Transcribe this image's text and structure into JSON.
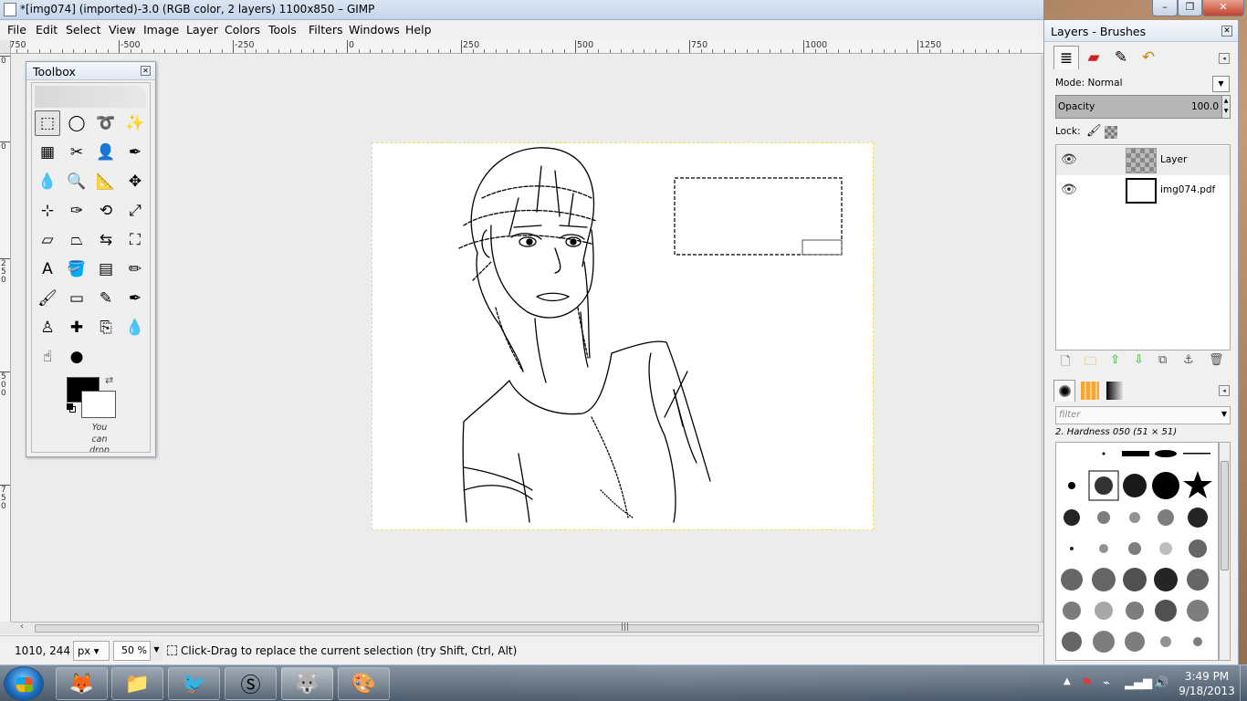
{
  "window": {
    "title": "*[img074] (imported)-3.0 (RGB color, 2 layers) 1100x850 – GIMP",
    "minimize": "–",
    "maximize": "❐",
    "close": "✕"
  },
  "menu": [
    "File",
    "Edit",
    "Select",
    "View",
    "Image",
    "Layer",
    "Colors",
    "Tools",
    "Filters",
    "Windows",
    "Help"
  ],
  "ruler": {
    "h_labels": [
      "-750",
      "-500",
      "-250",
      "0",
      "250",
      "500",
      "750",
      "1000",
      "1250"
    ],
    "v_labels": [
      "0",
      "0",
      "250",
      "500",
      "750"
    ]
  },
  "toolbox": {
    "title": "Toolbox",
    "close": "✕",
    "tools": [
      {
        "name": "rect-select-tool-icon",
        "glyph": "⬚"
      },
      {
        "name": "ellipse-select-tool-icon",
        "glyph": "◯"
      },
      {
        "name": "free-select-tool-icon",
        "glyph": "➰"
      },
      {
        "name": "fuzzy-select-tool-icon",
        "glyph": "✨"
      },
      {
        "name": "select-by-color-tool-icon",
        "glyph": "▦"
      },
      {
        "name": "scissors-select-tool-icon",
        "glyph": "✂"
      },
      {
        "name": "foreground-select-tool-icon",
        "glyph": "👤"
      },
      {
        "name": "paths-tool-icon",
        "glyph": "✒"
      },
      {
        "name": "color-picker-tool-icon",
        "glyph": "💧"
      },
      {
        "name": "zoom-tool-icon",
        "glyph": "🔍"
      },
      {
        "name": "measure-tool-icon",
        "glyph": "📐"
      },
      {
        "name": "move-tool-icon",
        "glyph": "✥"
      },
      {
        "name": "align-tool-icon",
        "glyph": "⊹"
      },
      {
        "name": "crop-tool-icon",
        "glyph": "✑"
      },
      {
        "name": "rotate-tool-icon",
        "glyph": "⟲"
      },
      {
        "name": "scale-tool-icon",
        "glyph": "⤢"
      },
      {
        "name": "shear-tool-icon",
        "glyph": "▱"
      },
      {
        "name": "perspective-tool-icon",
        "glyph": "⏢"
      },
      {
        "name": "flip-tool-icon",
        "glyph": "⇆"
      },
      {
        "name": "cage-transform-tool-icon",
        "glyph": "⛶"
      },
      {
        "name": "text-tool-icon",
        "glyph": "A"
      },
      {
        "name": "bucket-fill-tool-icon",
        "glyph": "🪣"
      },
      {
        "name": "blend-tool-icon",
        "glyph": "▤"
      },
      {
        "name": "pencil-tool-icon",
        "glyph": "✏"
      },
      {
        "name": "paintbrush-tool-icon",
        "glyph": "🖌"
      },
      {
        "name": "eraser-tool-icon",
        "glyph": "▭"
      },
      {
        "name": "airbrush-tool-icon",
        "glyph": "✎"
      },
      {
        "name": "ink-tool-icon",
        "glyph": "✒"
      },
      {
        "name": "clone-tool-icon",
        "glyph": "♙"
      },
      {
        "name": "heal-tool-icon",
        "glyph": "✚"
      },
      {
        "name": "perspective-clone-tool-icon",
        "glyph": "⎘"
      },
      {
        "name": "blur-sharpen-tool-icon",
        "glyph": "💧"
      },
      {
        "name": "smudge-tool-icon",
        "glyph": "☝"
      },
      {
        "name": "dodge-burn-tool-icon",
        "glyph": "●"
      }
    ],
    "drop_hint": "You can drop"
  },
  "status": {
    "coords": "1010, 244",
    "unit": "px",
    "zoom": "50 %",
    "message": "Click-Drag to replace the current selection (try Shift, Ctrl, Alt)"
  },
  "layers_dock": {
    "title": "Layers - Brushes",
    "close": "✕",
    "mode_label": "Mode:",
    "mode_value": "Normal",
    "opacity_label": "Opacity",
    "opacity_value": "100.0",
    "lock_label": "Lock:",
    "layers": [
      {
        "name": "Layer",
        "thumb": "checker"
      },
      {
        "name": "img074.pdf",
        "thumb": "doc"
      }
    ],
    "brush_filter_placeholder": "filter",
    "brush_name": "2. Hardness 050 (51 × 51)"
  },
  "taskbar": {
    "apps": [
      {
        "name": "firefox-icon",
        "glyph": "🦊"
      },
      {
        "name": "file-explorer-icon",
        "glyph": "📁"
      },
      {
        "name": "thunderbird-icon",
        "glyph": "🐦"
      },
      {
        "name": "skype-icon",
        "glyph": "Ⓢ"
      },
      {
        "name": "gimp-icon",
        "glyph": "🐺"
      },
      {
        "name": "paint-icon",
        "glyph": "🎨"
      }
    ],
    "time": "3:49 PM",
    "date": "9/18/2013"
  },
  "colors": {
    "foreground": "#000000",
    "background": "#ffffff"
  }
}
